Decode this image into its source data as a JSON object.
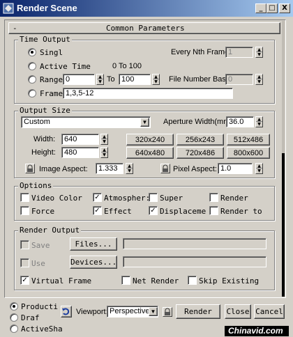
{
  "window": {
    "title": "Render Scene",
    "controls": [
      "_",
      "□",
      "X"
    ]
  },
  "rollout": {
    "sign": "-",
    "title": "Common Parameters"
  },
  "time_output": {
    "legend": "Time Output",
    "single": "Singl",
    "active_time": "Active Time",
    "active_range": "0 To 100",
    "range": "Range",
    "range_from": "0",
    "range_to_label": "To",
    "range_to": "100",
    "frames": "Frame",
    "frames_value": "1,3,5-12",
    "every_nth_label": "Every Nth Frame:",
    "every_nth_value": "1",
    "file_number_base_label": "File Number Base:",
    "file_number_base_value": "0"
  },
  "output_size": {
    "legend": "Output Size",
    "preset": "Custom",
    "aperture_label": "Aperture Width(mm):",
    "aperture_value": "36.0",
    "width_label": "Width:",
    "width_value": "640",
    "height_label": "Height:",
    "height_value": "480",
    "presets": [
      "320x240",
      "256x243",
      "512x486",
      "640x480",
      "720x486",
      "800x600"
    ],
    "image_aspect_label": "Image Aspect:",
    "image_aspect_value": "1.333",
    "pixel_aspect_label": "Pixel Aspect:",
    "pixel_aspect_value": "1.0"
  },
  "options": {
    "legend": "Options",
    "video_color": "Video Color",
    "atmospheric": "Atmospher:",
    "super_black": "Super",
    "render_hidden": "Render",
    "force_2sided": "Force",
    "effects": "Effect",
    "displacement": "Displaceme",
    "render_to_fields": "Render to"
  },
  "render_output": {
    "legend": "Render Output",
    "save_file": "Save",
    "files_button": "Files...",
    "use_device": "Use",
    "devices_button": "Devices...",
    "virtual_frame": "Virtual Frame",
    "net_render": "Net Render",
    "skip_existing": "Skip Existing"
  },
  "footer": {
    "production": "Producti",
    "draft": "Draf",
    "activeshade": "ActiveSha",
    "viewport_label": "Viewport:",
    "viewport_value": "Perspective",
    "render_button": "Render",
    "close_button": "Close",
    "cancel_button": "Cancel"
  },
  "watermark": "Chinavid.com",
  "colors": {
    "titlebar_start": "#0a246a",
    "titlebar_end": "#a6caf0",
    "face": "#d4d0c8"
  }
}
